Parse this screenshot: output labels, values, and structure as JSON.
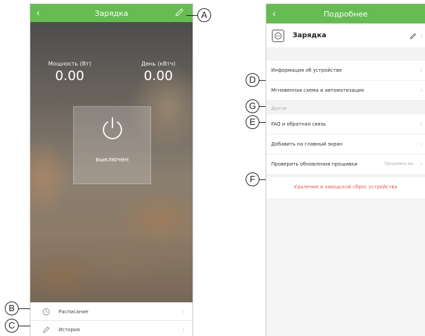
{
  "left_screen": {
    "title": "Зарядка",
    "power_label": "Мощность (Вт)",
    "power_value": "0.00",
    "day_label": "День (кВтч)",
    "day_value": "0.00",
    "power_state": "выключен",
    "schedule_label": "Расписание",
    "history_label": "История"
  },
  "right_screen": {
    "title": "Подробнее",
    "device_name": "Зарядка",
    "items": {
      "device_info": "Информация об устройстве",
      "scenes": "Мгновенная схема и автоматизация",
      "section_other": "Другое",
      "faq": "FAQ и обратная связь",
      "add_home": "Добавить на главный экран",
      "firmware": "Проверить обновления прошивки",
      "firmware_value": "Прошивка ва...",
      "reset": "Удаление и заводской сброс устройства"
    }
  },
  "callouts": {
    "a": "A",
    "b": "B",
    "c": "C",
    "d": "D",
    "e": "E",
    "f": "F",
    "g": "G"
  },
  "colors": {
    "accent_green": "#66bb52",
    "danger_red": "#e35a4f"
  },
  "icons": [
    "back-arrow-icon",
    "edit-pencil-icon",
    "power-icon",
    "clock-history-icon",
    "pencil-history-icon",
    "chevron-right-icon",
    "device-plug-icon"
  ]
}
